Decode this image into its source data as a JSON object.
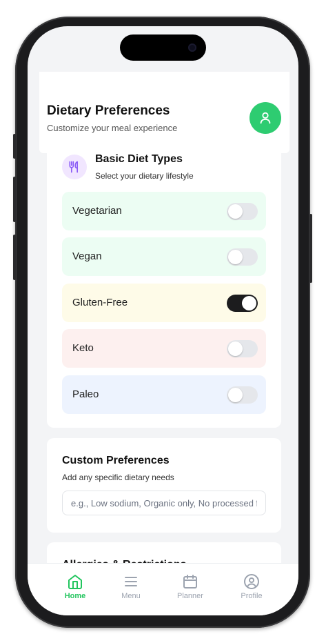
{
  "header": {
    "title": "Dietary Preferences",
    "subtitle": "Customize your meal experience",
    "avatar_icon": "user-icon"
  },
  "basic_diet": {
    "icon": "utensils-icon",
    "title": "Basic Diet Types",
    "subtitle": "Select your dietary lifestyle",
    "options": [
      {
        "label": "Vegetarian",
        "enabled": false,
        "bg": "#ecfdf3"
      },
      {
        "label": "Vegan",
        "enabled": false,
        "bg": "#ecfdf3"
      },
      {
        "label": "Gluten-Free",
        "enabled": true,
        "bg": "#fefbe8"
      },
      {
        "label": "Keto",
        "enabled": false,
        "bg": "#fdf0ef"
      },
      {
        "label": "Paleo",
        "enabled": false,
        "bg": "#edf3fe"
      }
    ]
  },
  "custom": {
    "title": "Custom Preferences",
    "subtitle": "Add any specific dietary needs",
    "placeholder": "e.g., Low sodium, Organic only, No processed foods"
  },
  "allergies": {
    "title": "Allergies & Restrictions"
  },
  "nav": {
    "items": [
      {
        "label": "Home",
        "icon": "home-icon",
        "active": true
      },
      {
        "label": "Menu",
        "icon": "menu-icon",
        "active": false
      },
      {
        "label": "Planner",
        "icon": "calendar-icon",
        "active": false
      },
      {
        "label": "Profile",
        "icon": "profile-icon",
        "active": false
      }
    ]
  },
  "colors": {
    "accent": "#22c55e",
    "toggle_on": "#1c1c1e",
    "toggle_off": "#e5e7eb"
  }
}
